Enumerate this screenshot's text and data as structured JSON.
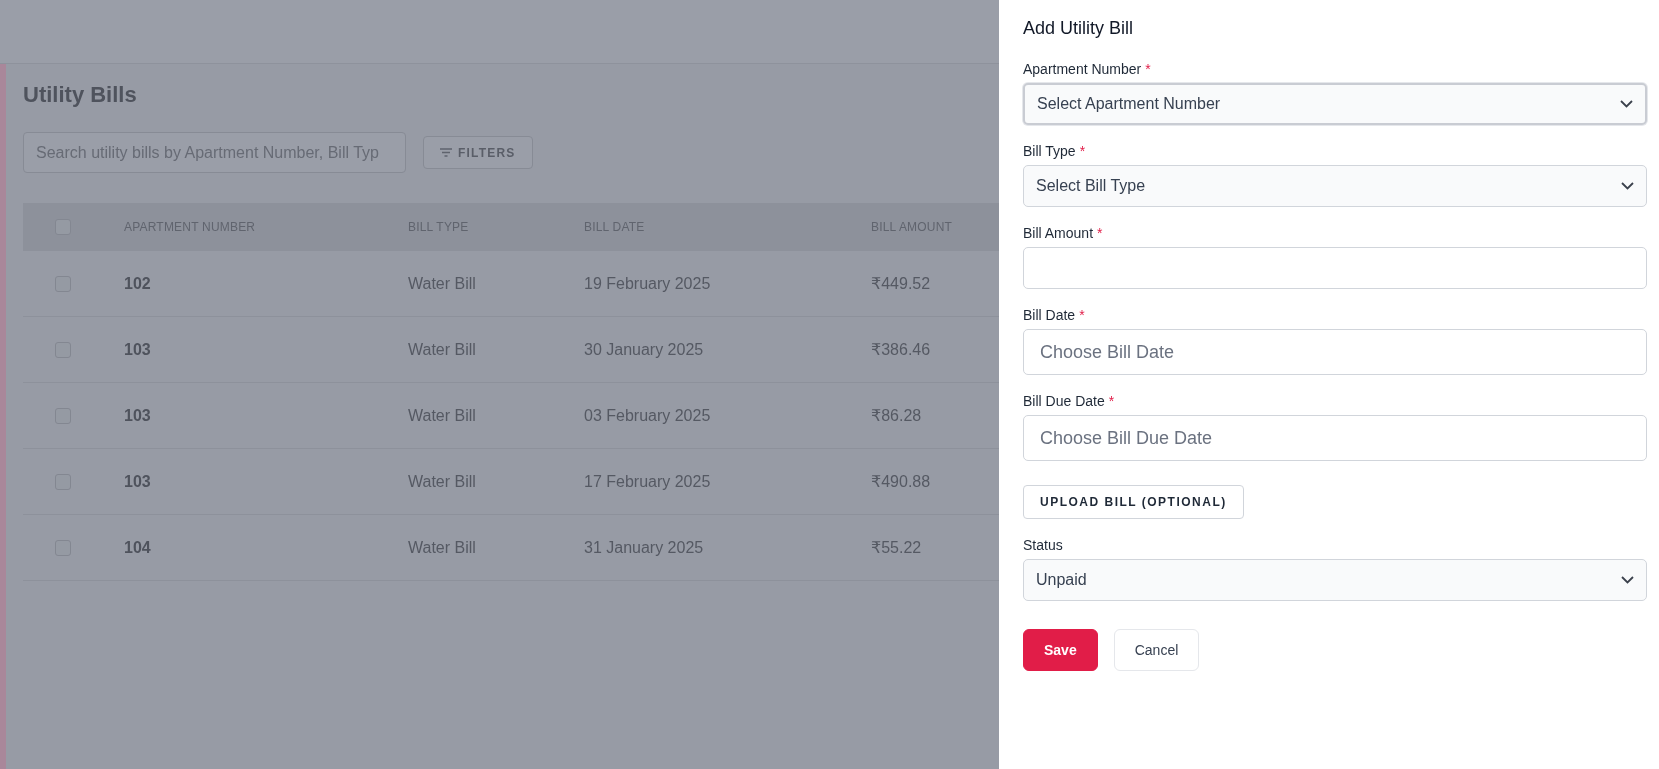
{
  "page": {
    "title": "Utility Bills",
    "search": {
      "placeholder": "Search utility bills by Apartment Number, Bill Typ"
    },
    "filters_button": "FILTERS"
  },
  "table": {
    "header_checked": false,
    "columns": [
      "APARTMENT NUMBER",
      "BILL TYPE",
      "BILL DATE",
      "BILL AMOUNT"
    ],
    "rows": [
      {
        "checked": false,
        "cells": [
          "102",
          "Water Bill",
          "19 February 2025",
          "₹449.52"
        ]
      },
      {
        "checked": false,
        "cells": [
          "103",
          "Water Bill",
          "30 January 2025",
          "₹386.46"
        ]
      },
      {
        "checked": false,
        "cells": [
          "103",
          "Water Bill",
          "03 February 2025",
          "₹86.28"
        ]
      },
      {
        "checked": false,
        "cells": [
          "103",
          "Water Bill",
          "17 February 2025",
          "₹490.88"
        ]
      },
      {
        "checked": false,
        "cells": [
          "104",
          "Water Bill",
          "31 January 2025",
          "₹55.22"
        ]
      }
    ]
  },
  "drawer": {
    "title": "Add Utility Bill",
    "fields": [
      {
        "kind": "select",
        "label": "Apartment Number",
        "required_mark": "*",
        "text": "Select Apartment Number",
        "focused": true
      },
      {
        "kind": "select",
        "label": "Bill Type",
        "required_mark": "*",
        "text": "Select Bill Type",
        "focused": false
      },
      {
        "kind": "input",
        "label": "Bill Amount",
        "required_mark": "*",
        "focused": false
      },
      {
        "kind": "date",
        "label": "Bill Date",
        "required_mark": "*",
        "placeholder": "Choose Bill Date",
        "focused": false
      },
      {
        "kind": "date",
        "label": "Bill Due Date",
        "required_mark": "*",
        "placeholder": "Choose Bill Due Date",
        "focused": false
      },
      {
        "kind": "upload",
        "text": "UPLOAD BILL (OPTIONAL)"
      },
      {
        "kind": "select",
        "label": "Status",
        "text": "Unpaid",
        "focused": false
      }
    ],
    "buttons": [
      {
        "label": "Save",
        "primary": true
      },
      {
        "label": "Cancel",
        "primary": false
      }
    ]
  }
}
